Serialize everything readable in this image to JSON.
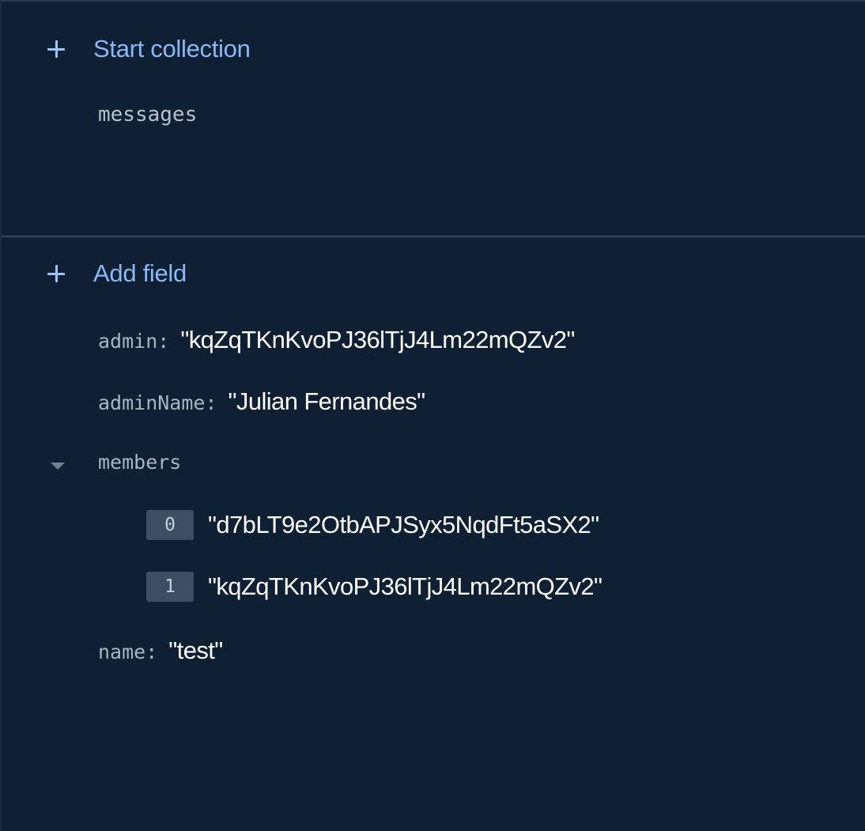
{
  "collections": {
    "start_label": "Start collection",
    "items": [
      "messages"
    ]
  },
  "fields": {
    "add_label": "Add field",
    "admin": {
      "key": "admin",
      "value": "\"kqZqTKnKvoPJ36lTjJ4Lm22mQZv2\""
    },
    "adminName": {
      "key": "adminName",
      "value": "\"Julian Fernandes\""
    },
    "members": {
      "key": "members",
      "items": [
        {
          "index": "0",
          "value": "\"d7bLT9e2OtbAPJSyx5NqdFt5aSX2\""
        },
        {
          "index": "1",
          "value": "\"kqZqTKnKvoPJ36lTjJ4Lm22mQZv2\""
        }
      ]
    },
    "name": {
      "key": "name",
      "value": "\"test\""
    },
    "colon": ":"
  },
  "icons": {
    "add": "plus-icon",
    "expand": "caret-down-icon"
  },
  "colors": {
    "background": "#0f2035",
    "accent": "#8ab8f4",
    "divider": "#34475c"
  }
}
